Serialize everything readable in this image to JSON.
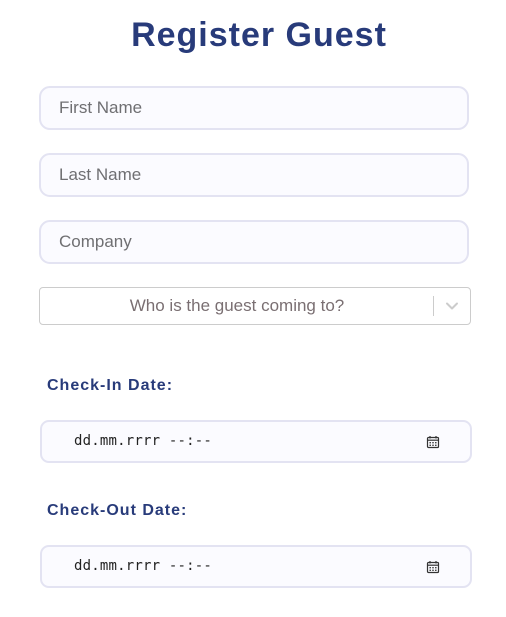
{
  "form": {
    "title": "Register Guest",
    "first_name": {
      "placeholder": "First Name",
      "value": ""
    },
    "last_name": {
      "placeholder": "Last Name",
      "value": ""
    },
    "company": {
      "placeholder": "Company",
      "value": ""
    },
    "host_select": {
      "placeholder": "Who is the guest coming to?",
      "icon": "chevron-down-icon"
    },
    "check_in": {
      "label": "Check-In Date:",
      "value_display": "dd.mm.rrrr --:--",
      "icon": "calendar-icon"
    },
    "check_out": {
      "label": "Check-Out Date:",
      "value_display": "dd.mm.rrrr --:--",
      "icon": "calendar-icon"
    }
  },
  "colors": {
    "title": "#283b7a",
    "label": "#283b7a",
    "input_border": "#e3e3f2",
    "input_background": "#fbfbff",
    "select_border": "#cccccc"
  }
}
